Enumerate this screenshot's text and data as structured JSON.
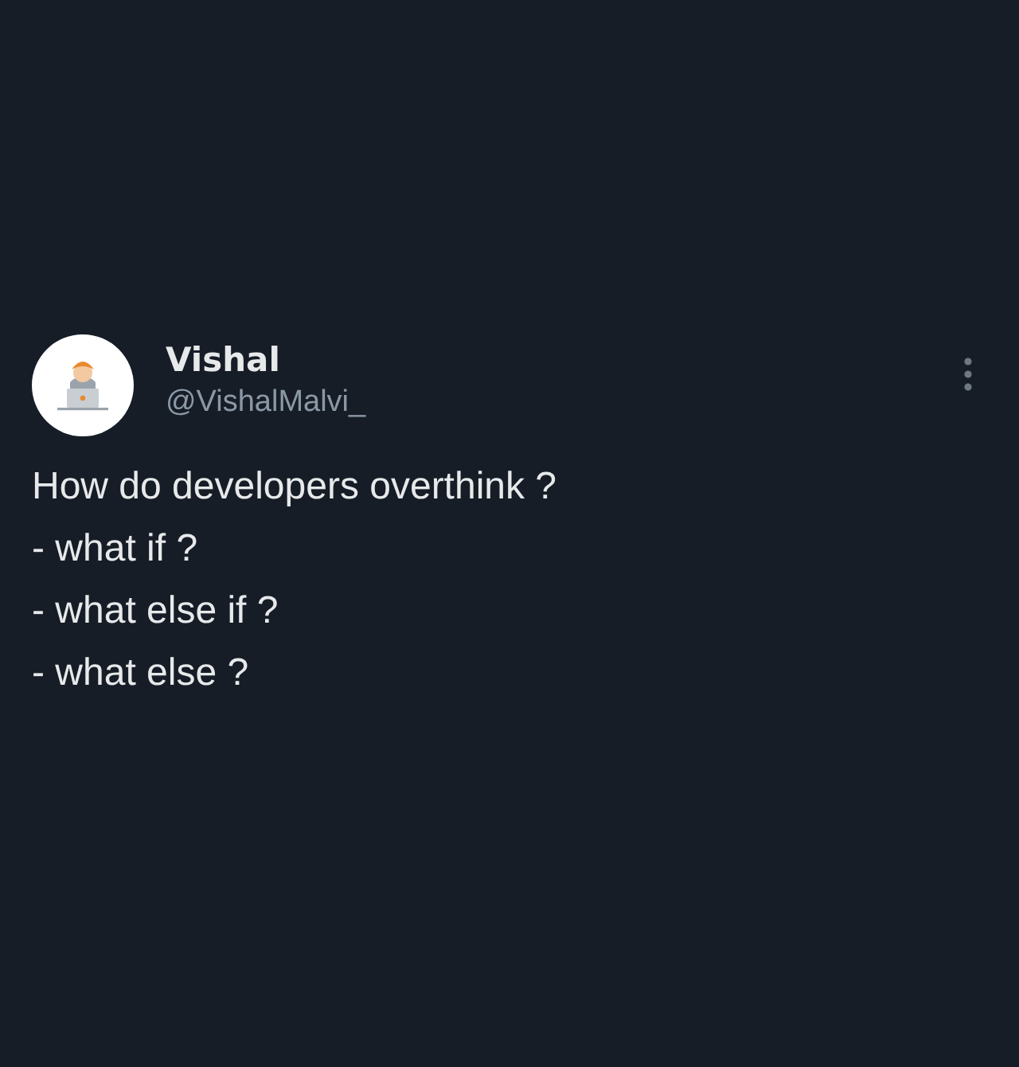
{
  "post": {
    "author_name": "Vishal",
    "handle": "@VishalMalvi_",
    "body_lines": [
      "How do developers overthink ?",
      "- what if ?",
      "- what else if ?",
      "- what else ?"
    ]
  }
}
